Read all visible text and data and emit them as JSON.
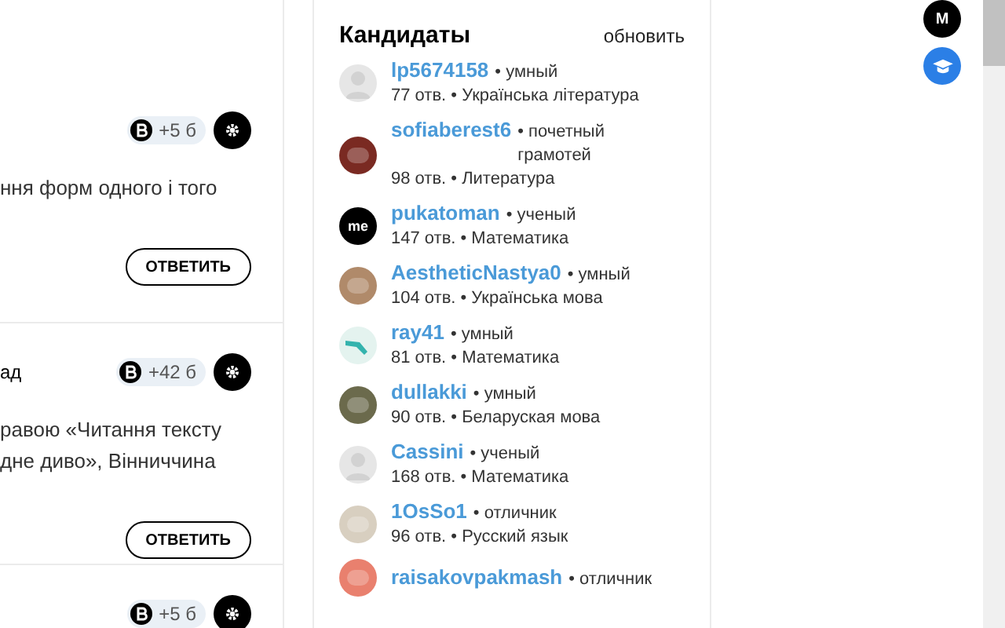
{
  "questions": [
    {
      "points": "+5 б",
      "text_lines": [
        "ння форм одного і того"
      ],
      "answer_button": "ОТВЕТИТЬ"
    },
    {
      "subject_tail": "ад",
      "points": "+42 б",
      "text_lines": [
        "равою «Читання тексту",
        "дне диво», Вінниччина"
      ],
      "answer_button": "ОТВЕТИТЬ"
    },
    {
      "points": "+5 б"
    }
  ],
  "candidates": {
    "title": "Кандидаты",
    "refresh": "обновить",
    "items": [
      {
        "name": "lp5674158",
        "rank": "• умный",
        "stats": "77 отв. • Українська лiтература",
        "avatar": {
          "kind": "silhouette",
          "color": "#e6e6e6"
        }
      },
      {
        "name": "sofiaberest6",
        "rank": "• почетный грамотей",
        "stats": "98 отв. • Литература",
        "avatar": {
          "kind": "photo",
          "color": "#7a2a22"
        }
      },
      {
        "name": "pukatoman",
        "rank": "• ученый",
        "stats": "147 отв. • Математика",
        "avatar": {
          "kind": "initials",
          "color": "#000000",
          "text": "me"
        }
      },
      {
        "name": "AestheticNastya0",
        "rank": "• умный",
        "stats": "104 отв. • Українська мова",
        "avatar": {
          "kind": "photo",
          "color": "#b08a6a"
        }
      },
      {
        "name": "ray41",
        "rank": "• умный",
        "stats": "81 отв. • Математика",
        "avatar": {
          "kind": "shape",
          "color": "#e4f3ef"
        }
      },
      {
        "name": "dullakki",
        "rank": "• умный",
        "stats": "90 отв. • Беларуская мова",
        "avatar": {
          "kind": "photo",
          "color": "#6b6a4c"
        }
      },
      {
        "name": "Cassini",
        "rank": "• ученый",
        "stats": "168 отв. • Математика",
        "avatar": {
          "kind": "silhouette",
          "color": "#e6e6e6"
        }
      },
      {
        "name": "1OsSo1",
        "rank": "• отличник",
        "stats": "96 отв. • Русский язык",
        "avatar": {
          "kind": "photo",
          "color": "#d8cfc0"
        }
      },
      {
        "name": "raisakovpakmash",
        "rank": "• отличник",
        "avatar": {
          "kind": "photo",
          "color": "#e9806e"
        }
      }
    ]
  },
  "user_avatar": "M"
}
